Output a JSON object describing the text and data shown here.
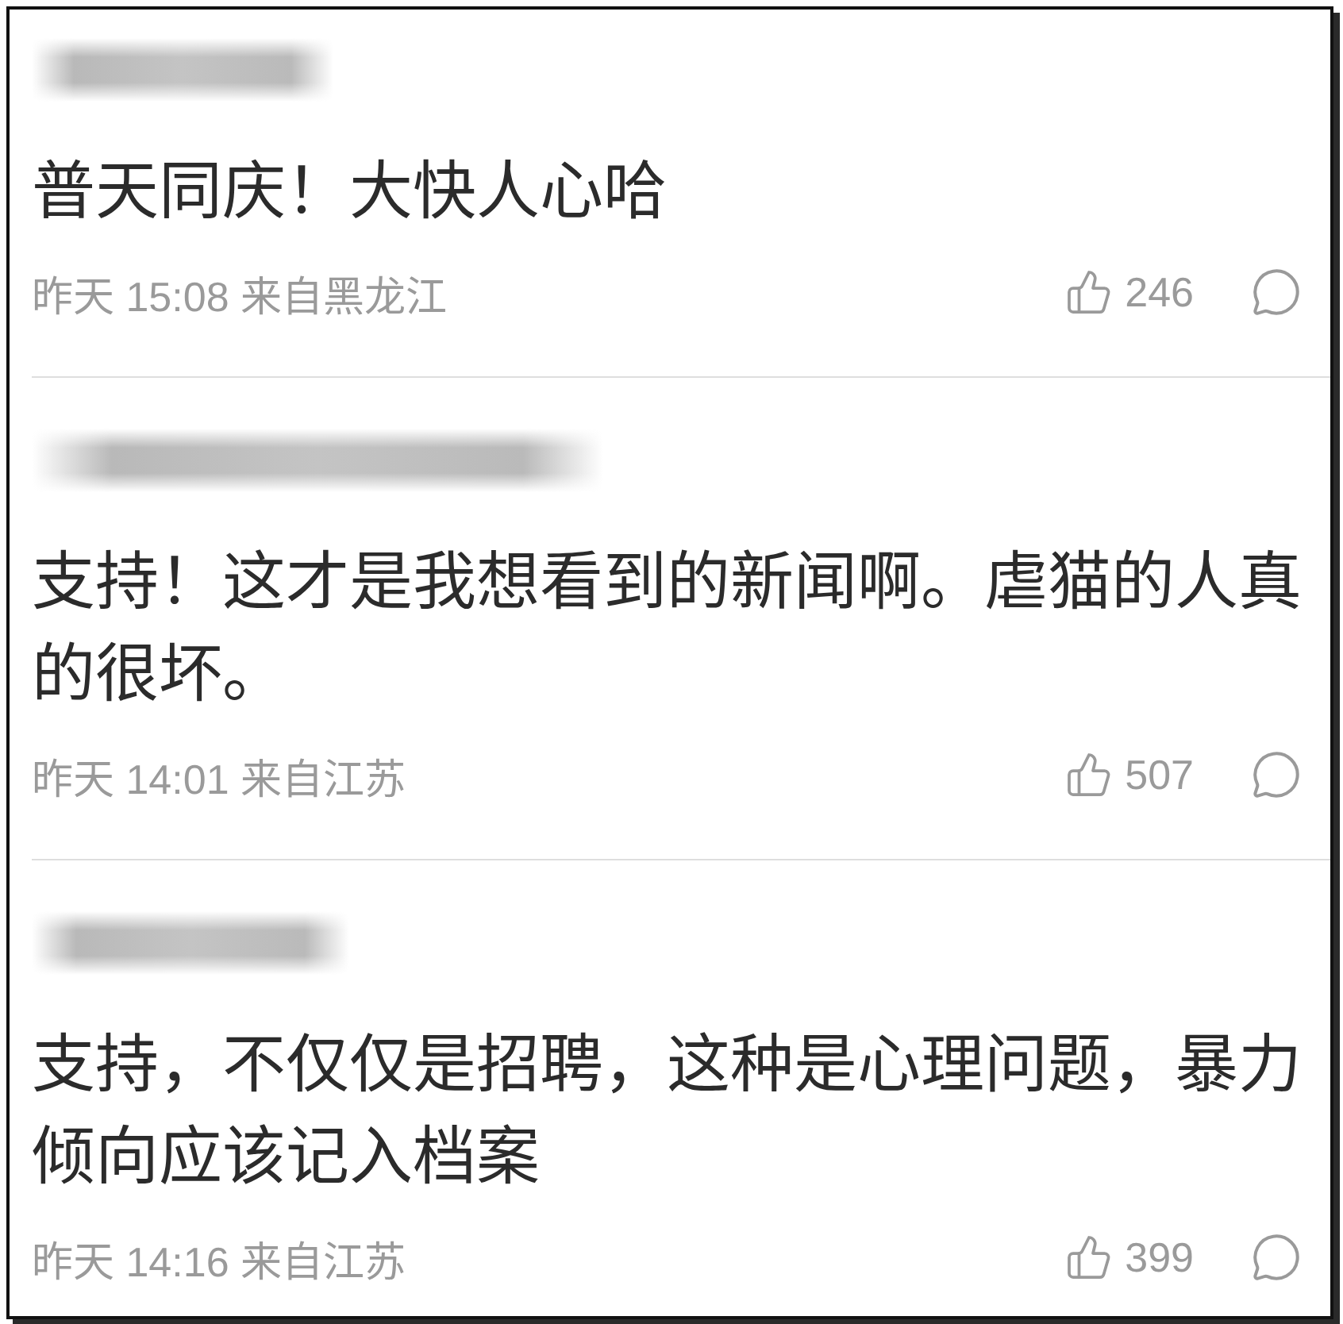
{
  "comments": [
    {
      "text": "普天同庆！大快人心哈",
      "meta": "昨天 15:08 来自黑龙江",
      "likes": "246"
    },
    {
      "text": "支持！这才是我想看到的新闻啊。虐猫的人真的很坏。",
      "meta": "昨天 14:01 来自江苏",
      "likes": "507"
    },
    {
      "text": "支持，不仅仅是招聘，这种是心理问题，暴力倾向应该记入档案",
      "meta": "昨天 14:16 来自江苏",
      "likes": "399"
    }
  ]
}
